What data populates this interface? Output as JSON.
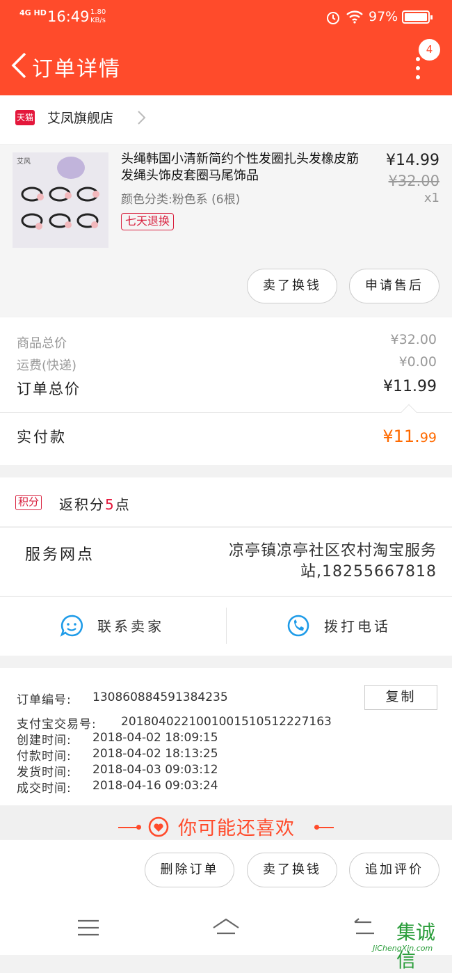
{
  "status_bar": {
    "network": "4G HD",
    "time": "16:49",
    "speed": "1.80\nKB/s",
    "battery": "97%"
  },
  "header": {
    "title": "订单详情",
    "badge_count": "4"
  },
  "shop": {
    "tag": "天猫",
    "name": "艾凤旗舰店"
  },
  "product": {
    "title": "头绳韩国小清新简约个性发圈扎头发橡皮筋发绳头饰皮套圈马尾饰品",
    "spec": "颜色分类:粉色系 (6根)",
    "tag": "七天退换",
    "price": "¥14.99",
    "original_price": "¥32.00",
    "quantity": "x1",
    "thumb_brand": "艾风"
  },
  "item_actions": {
    "sell": "卖了换钱",
    "after_sale": "申请售后"
  },
  "summary": {
    "goods_label": "商品总价",
    "goods_value": "¥32.00",
    "shipping_label": "运费(快递)",
    "shipping_value": "¥0.00",
    "total_label": "订单总价",
    "total_value": "¥11.99",
    "paid_label": "实付款",
    "paid_value_main": "¥11.",
    "paid_value_cents": "99"
  },
  "points": {
    "tag": "积分",
    "text_pre": "返积分",
    "num": "5",
    "text_post": "点"
  },
  "service": {
    "label": "服务网点",
    "value": "凉亭镇凉亭社区农村淘宝服务站,18255667818"
  },
  "contact": {
    "seller": "联系卖家",
    "call": "拨打电话"
  },
  "order_info": {
    "order_no_label": "订单编号:",
    "order_no": "130860884591384235",
    "copy": "复制",
    "alipay_label": "支付宝交易号:",
    "alipay_no": "2018040221001001510512227163",
    "created_label": "创建时间:",
    "created": "2018-04-02 18:09:15",
    "paid_label": "付款时间:",
    "paid": "2018-04-02 18:13:25",
    "shipped_label": "发货时间:",
    "shipped": "2018-04-03 09:03:12",
    "done_label": "成交时间:",
    "done": "2018-04-16 09:03:24"
  },
  "recommend": {
    "title": "你可能还喜欢"
  },
  "bottom_actions": {
    "delete": "删除订单",
    "sell": "卖了换钱",
    "review": "追加评价"
  },
  "watermark": {
    "big": "集诚信",
    "small": "JiChengXin.com"
  },
  "colors": {
    "brand": "#ff4b2b",
    "paid": "#ff6a00",
    "tmall": "#e4173b"
  }
}
